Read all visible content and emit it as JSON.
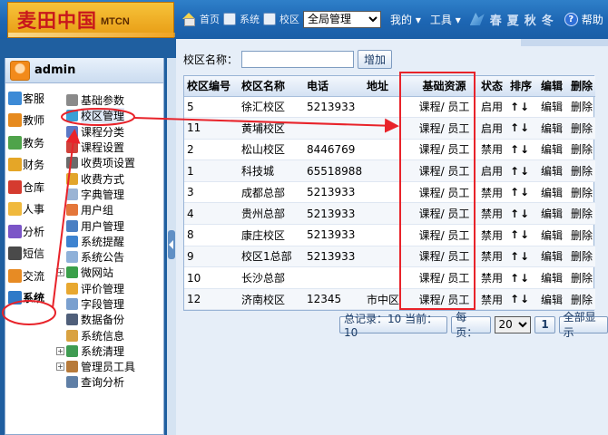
{
  "header": {
    "brand_cn": "麦田中国",
    "brand_en": "MTCN",
    "home_text": "首页",
    "overlap_text_1": "系统",
    "overlap_text_2": "校区",
    "campus_selected": "全局管理",
    "menu_mine": "我的",
    "menu_tools": "工具",
    "seasons": [
      "春",
      "夏",
      "秋",
      "冬"
    ],
    "help": "帮助"
  },
  "user": {
    "name": "admin"
  },
  "modules": [
    {
      "label": "客服",
      "color": "#3c8ad6"
    },
    {
      "label": "教师",
      "color": "#e68a1e"
    },
    {
      "label": "教务",
      "color": "#4fa34a"
    },
    {
      "label": "财务",
      "color": "#e5a627"
    },
    {
      "label": "仓库",
      "color": "#d53b2f"
    },
    {
      "label": "人事",
      "color": "#f0b93d"
    },
    {
      "label": "分析",
      "color": "#7b55c7"
    },
    {
      "label": "短信",
      "color": "#4a4a4a"
    },
    {
      "label": "交流",
      "color": "#e78b24"
    },
    {
      "label": "系统",
      "color": "#2f7ac8"
    }
  ],
  "tree": [
    {
      "label": "基础参数",
      "expander": "",
      "color": "#8a8a8a"
    },
    {
      "label": "校区管理",
      "expander": "",
      "color": "#3aa0d6"
    },
    {
      "label": "课程分类",
      "expander": "",
      "color": "#5a78c6"
    },
    {
      "label": "课程设置",
      "expander": "",
      "color": "#d0413a"
    },
    {
      "label": "收费项设置",
      "expander": "",
      "color": "#6b6b6b"
    },
    {
      "label": "收费方式",
      "expander": "",
      "color": "#e2a52b"
    },
    {
      "label": "字典管理",
      "expander": "",
      "color": "#9bb4d4"
    },
    {
      "label": "用户组",
      "expander": "",
      "color": "#e4763a"
    },
    {
      "label": "用户管理",
      "expander": "",
      "color": "#4b7fc3"
    },
    {
      "label": "系统提醒",
      "expander": "",
      "color": "#3d83d0"
    },
    {
      "label": "系统公告",
      "expander": "",
      "color": "#8fb1d9"
    },
    {
      "label": "微网站",
      "expander": "+",
      "color": "#3aa04a"
    },
    {
      "label": "评价管理",
      "expander": "",
      "color": "#e8a830"
    },
    {
      "label": "字段管理",
      "expander": "",
      "color": "#7aa0cf"
    },
    {
      "label": "数据备份",
      "expander": "",
      "color": "#4f5f7a"
    },
    {
      "label": "系统信息",
      "expander": "",
      "color": "#d9a241"
    },
    {
      "label": "系统清理",
      "expander": "+",
      "color": "#3f9c52"
    },
    {
      "label": "管理员工具",
      "expander": "+",
      "color": "#b77a3a"
    },
    {
      "label": "查询分析",
      "expander": "",
      "color": "#5f7fa6"
    }
  ],
  "search": {
    "label": "校区名称：",
    "value": "",
    "add_button": "增加"
  },
  "table": {
    "headers": [
      "校区编号",
      "校区名称",
      "电话",
      "地址",
      "基础资源",
      "状态",
      "排序",
      "编辑",
      "删除"
    ],
    "rows": [
      [
        "5",
        "徐汇校区",
        "5213933",
        "",
        "课程/ 员工",
        "启用",
        "↑↓",
        "编辑",
        "删除"
      ],
      [
        "11",
        "黄埔校区",
        "",
        "",
        "课程/ 员工",
        "启用",
        "↑↓",
        "编辑",
        "删除"
      ],
      [
        "2",
        "松山校区",
        "8446769",
        "",
        "课程/ 员工",
        "禁用",
        "↑↓",
        "编辑",
        "删除"
      ],
      [
        "1",
        "科技城",
        "65518988",
        "",
        "课程/ 员工",
        "启用",
        "↑↓",
        "编辑",
        "删除"
      ],
      [
        "3",
        "成都总部",
        "5213933",
        "",
        "课程/ 员工",
        "禁用",
        "↑↓",
        "编辑",
        "删除"
      ],
      [
        "4",
        "贵州总部",
        "5213933",
        "",
        "课程/ 员工",
        "禁用",
        "↑↓",
        "编辑",
        "删除"
      ],
      [
        "8",
        "康庄校区",
        "5213933",
        "",
        "课程/ 员工",
        "禁用",
        "↑↓",
        "编辑",
        "删除"
      ],
      [
        "9",
        "校区1总部",
        "5213933",
        "",
        "课程/ 员工",
        "禁用",
        "↑↓",
        "编辑",
        "删除"
      ],
      [
        "10",
        "长沙总部",
        "",
        "",
        "课程/ 员工",
        "禁用",
        "↑↓",
        "编辑",
        "删除"
      ],
      [
        "12",
        "济南校区",
        "12345",
        "市中区",
        "课程/ 员工",
        "禁用",
        "↑↓",
        "编辑",
        "删除"
      ]
    ]
  },
  "pager": {
    "summary": "总记录：10 当前：10",
    "per_page_label": "每页：",
    "per_page": "20",
    "current_page": "1",
    "show_all": "全部显示"
  },
  "annotation_color": "#e8232a"
}
